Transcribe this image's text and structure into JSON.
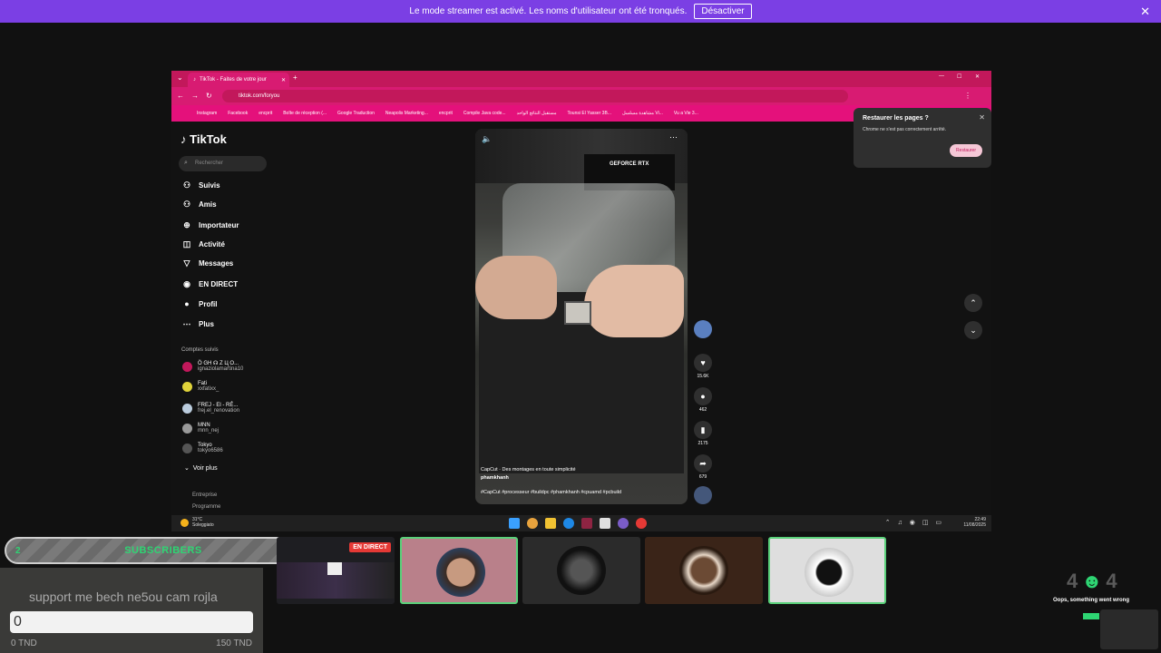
{
  "banner": {
    "text": "Le mode streamer est activé. Les noms d'utilisateur ont été tronqués.",
    "button": "Désactiver",
    "close": "✕"
  },
  "browser": {
    "tab_title": "TikTok - Faites de votre jour",
    "url": "tiktok.com/foryou",
    "bookmarks": [
      "Instagram",
      "Facebook",
      "encprit",
      "Boîte de réception (...",
      "Google Traduction",
      "Neapolis Marketing...",
      "encprit",
      "Compile Java code...",
      "مستقبل النتائج الواحد",
      "Tounsi El Yasser 3B...",
      "مشاهدة مسلسل Vi...",
      "Vu a Vie 3..."
    ]
  },
  "restore_popup": {
    "title": "Restaurer les pages ?",
    "message": "Chrome ne s'est pas correctement arrêté.",
    "button": "Restaurer"
  },
  "tiktok": {
    "logo": "TikTok",
    "search_placeholder": "Rechercher",
    "nav": [
      {
        "label": "Suivis",
        "icon": "person-plus-icon",
        "glyph": "⚇"
      },
      {
        "label": "Amis",
        "icon": "friends-icon",
        "glyph": "⚇"
      },
      {
        "label": "Importateur",
        "icon": "upload-icon",
        "glyph": "⊕"
      },
      {
        "label": "Activité",
        "icon": "activity-icon",
        "glyph": "◫"
      },
      {
        "label": "Messages",
        "icon": "messages-icon",
        "glyph": "▽"
      },
      {
        "label": "EN DIRECT",
        "icon": "live-icon",
        "glyph": "◉"
      },
      {
        "label": "Profil",
        "icon": "profile-icon",
        "glyph": "●"
      },
      {
        "label": "Plus",
        "icon": "more-icon",
        "glyph": "⋯"
      }
    ],
    "followed_title": "Comptes suivis",
    "followed": [
      {
        "name": "Ö GH ☊ Z Ц O...",
        "user": "ignaziolamartina10"
      },
      {
        "name": "Fati",
        "user": "xxfatixx_"
      },
      {
        "name": "FREJ - El - RÉ...",
        "user": "frej.el_renovation"
      },
      {
        "name": "MNN",
        "user": "mnn_nej"
      },
      {
        "name": "Tokyo",
        "user": "tokyo6586"
      }
    ],
    "see_more": "Voir plus",
    "footer": [
      "Entreprise",
      "Programme"
    ],
    "video": {
      "gpu_label": "GEFORCE RTX",
      "capcut": "CapCut · Des montages en toute simplicité",
      "author": "phamkhanh",
      "hashtags": "#CapCut #processeur #buildpc #phamkhanh #cpuamd #pcbuild"
    },
    "actions": {
      "likes": "15.6K",
      "comments": "462",
      "saves": "2175",
      "shares": "679"
    }
  },
  "taskbar": {
    "weather_temp": "31°C",
    "weather_desc": "Soleggiato",
    "time": "22:49",
    "date": "11/08/2025"
  },
  "subscribers": {
    "current": "2",
    "label": "SUBSCRIBERS",
    "goal": "0"
  },
  "donation": {
    "message": "support me bech ne5ou cam rojla",
    "value": "0",
    "min": "0 TND",
    "max": "150 TND"
  },
  "live_badge": "EN DIRECT",
  "error_widget": {
    "code_a": "4",
    "code_b": "4",
    "message": "Oops, something went wrong"
  },
  "colors": {
    "banner": "#7b3fe4",
    "browser_accent": "#d81b72",
    "subscriber_green": "#2ed573"
  }
}
